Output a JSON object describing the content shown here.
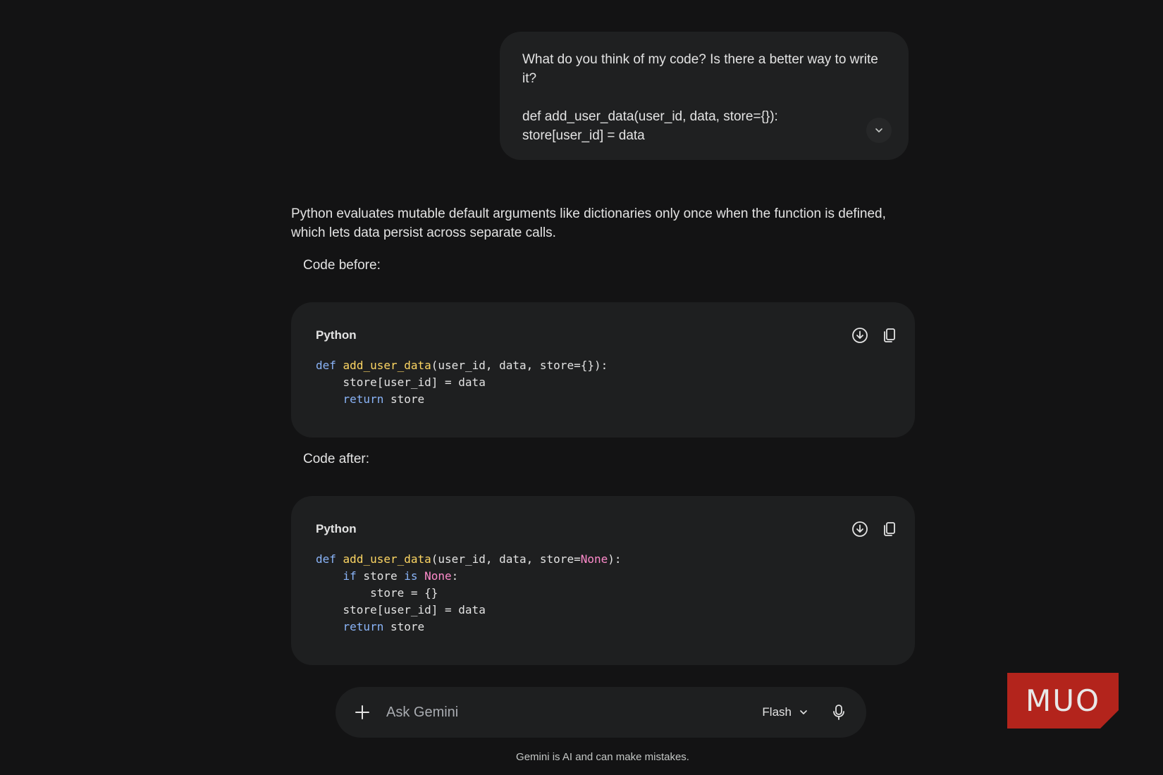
{
  "user_message": {
    "question": "What do you think of my code? Is there a better way to write it?",
    "code_lines": [
      "def add_user_data(user_id, data, store={}):",
      "store[user_id] = data"
    ],
    "expand_icon": "chevron-down-icon"
  },
  "response": {
    "intro": "Python evaluates mutable default arguments like dictionaries only once when the function is defined, which lets data persist across separate calls.",
    "label_before": "Code before:",
    "label_after": "Code after:",
    "code_before": {
      "language": "Python",
      "lines": [
        "def add_user_data(user_id, data, store={}):",
        "    store[user_id] = data",
        "    return store"
      ]
    },
    "code_after": {
      "language": "Python",
      "lines": [
        "def add_user_data(user_id, data, store=None):",
        "    if store is None:",
        "        store = {}",
        "    store[user_id] = data",
        "    return store"
      ]
    },
    "code_actions": [
      "download-icon",
      "copy-icon"
    ]
  },
  "input_bar": {
    "placeholder": "Ask Gemini",
    "model": "Flash",
    "icons": [
      "plus-icon",
      "chevron-down-icon",
      "microphone-icon"
    ]
  },
  "footer": {
    "disclaimer": "Gemini is AI and can make mistakes."
  },
  "watermark": {
    "text": "MUO"
  },
  "colors": {
    "background": "#131314",
    "surface": "#1e1f20",
    "text": "#e3e3e3",
    "keyword": "#8ab4f8",
    "function": "#fdd663",
    "constant": "#ff8bcb",
    "logo": "#b3241c"
  }
}
